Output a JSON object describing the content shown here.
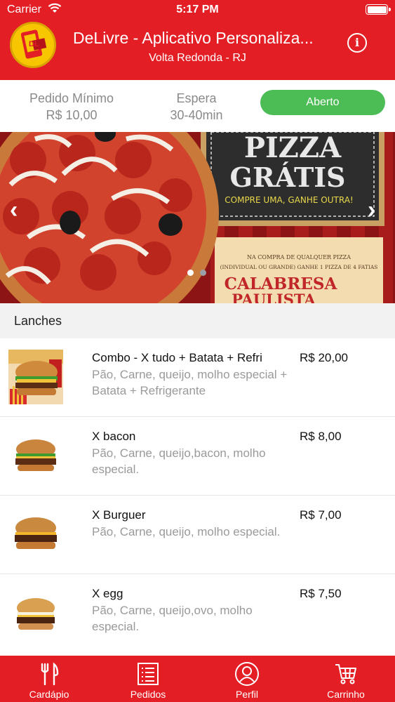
{
  "status_bar": {
    "carrier": "Carrier",
    "time": "5:17 PM"
  },
  "header": {
    "title": "DeLivre - Aplicativo Personaliza...",
    "subtitle": "Volta Redonda - RJ",
    "logo_text": "DL"
  },
  "info": {
    "min_order_label": "Pedido Mínimo",
    "min_order_value": "R$ 10,00",
    "wait_label": "Espera",
    "wait_value": "30-40min",
    "status_button": "Aberto"
  },
  "banner": {
    "headline_1": "PIZZA",
    "headline_2": "GRÁTIS",
    "tagline": "COMPRE UMA, GANHE OUTRA!",
    "fine_print_1": "NA COMPRA DE QUALQUER PIZZA",
    "fine_print_2": "(INDIVIDUAL OU GRANDE) GANHE 1 PIZZA DE 4 FATIAS",
    "flavor_1": "CALABRESA",
    "flavor_2": "PAULISTA",
    "slide_count": 2,
    "active_slide": 1
  },
  "section": {
    "title": "Lanches"
  },
  "products": [
    {
      "name": "Combo - X tudo + Batata + Refri",
      "description": "Pão, Carne, queijo, molho especial + Batata + Refrigerante",
      "price": "R$ 20,00"
    },
    {
      "name": "X bacon",
      "description": "Pão, Carne, queijo,bacon, molho especial.",
      "price": "R$ 8,00"
    },
    {
      "name": "X Burguer",
      "description": "Pão, Carne, queijo, molho especial.",
      "price": "R$ 7,00"
    },
    {
      "name": "X egg",
      "description": "Pão, Carne, queijo,ovo,  molho especial.",
      "price": "R$ 7,50"
    }
  ],
  "tabs": [
    {
      "label": "Cardápio",
      "icon": "fork-knife-icon"
    },
    {
      "label": "Pedidos",
      "icon": "list-icon"
    },
    {
      "label": "Perfil",
      "icon": "user-icon"
    },
    {
      "label": "Carrinho",
      "icon": "cart-icon"
    }
  ],
  "colors": {
    "primary": "#e31e24",
    "open": "#4cbc55",
    "muted": "#8a8a8a"
  }
}
